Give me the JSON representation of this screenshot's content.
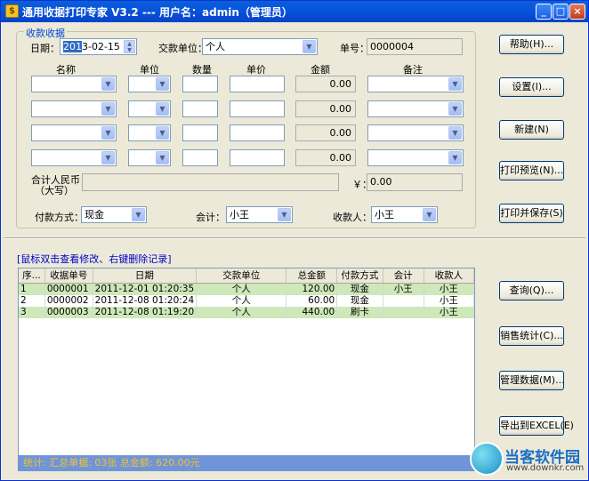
{
  "window": {
    "title": "通用收据打印专家 V3.2 --- 用户名：admin（管理员）",
    "minimize": "_",
    "maximize": "□",
    "close": "×"
  },
  "receipt_group": {
    "title": "收款收据",
    "date_label": "日期：",
    "date_value": "2013-02-15",
    "date_selected_part": "201",
    "date_rest": "3-02-15",
    "party_label": "交款单位：",
    "party_value": "个人",
    "number_label": "单号：",
    "number_value": "0000004",
    "headers": {
      "name": "名称",
      "unit": "单位",
      "qty": "数量",
      "price": "单价",
      "amount": "金额",
      "remark": "备注"
    },
    "rows": [
      {
        "amount": "0.00"
      },
      {
        "amount": "0.00"
      },
      {
        "amount": "0.00"
      },
      {
        "amount": "0.00"
      }
    ],
    "total_label_line1": "合计人民币",
    "total_label_line2": "（大写）",
    "yen_label": "￥：",
    "total_value": "0.00",
    "payment_label": "付款方式：",
    "payment_value": "现金",
    "accountant_label": "会计：",
    "accountant_value": "小王",
    "payee_label": "收款人：",
    "payee_value": "小王"
  },
  "right_buttons": {
    "help": "帮助(H)...",
    "settings": "设置(I)...",
    "new": "新建(N)",
    "print_preview": "打印预览(N)...",
    "print_save": "打印并保存(S)"
  },
  "records": {
    "hint": "[鼠标双击查看修改、右键删除记录]",
    "columns": [
      "序...",
      "收据单号",
      "日期",
      "交款单位",
      "总金额",
      "付款方式",
      "会计",
      "收款人"
    ],
    "rows": [
      [
        "1",
        "0000001",
        "2011-12-01 01:20:35",
        "个人",
        "120.00",
        "现金",
        "小王",
        "小王"
      ],
      [
        "2",
        "0000002",
        "2011-12-08 01:20:24",
        "个人",
        "60.00",
        "现金",
        "",
        "小王"
      ],
      [
        "3",
        "0000003",
        "2011-12-08 01:19:20",
        "个人",
        "440.00",
        "刷卡",
        "",
        "小王"
      ]
    ],
    "status": "统计:    汇总单据: 03张     总金额: 620.00元"
  },
  "lower_buttons": {
    "query": "查询(Q)...",
    "sales_stats": "销售统计(C)...",
    "manage_data": "管理数据(M)...",
    "export_excel": "导出到EXCEL(E)"
  },
  "watermark": {
    "brand": "当客软件园",
    "url": "www.downkr.com"
  }
}
